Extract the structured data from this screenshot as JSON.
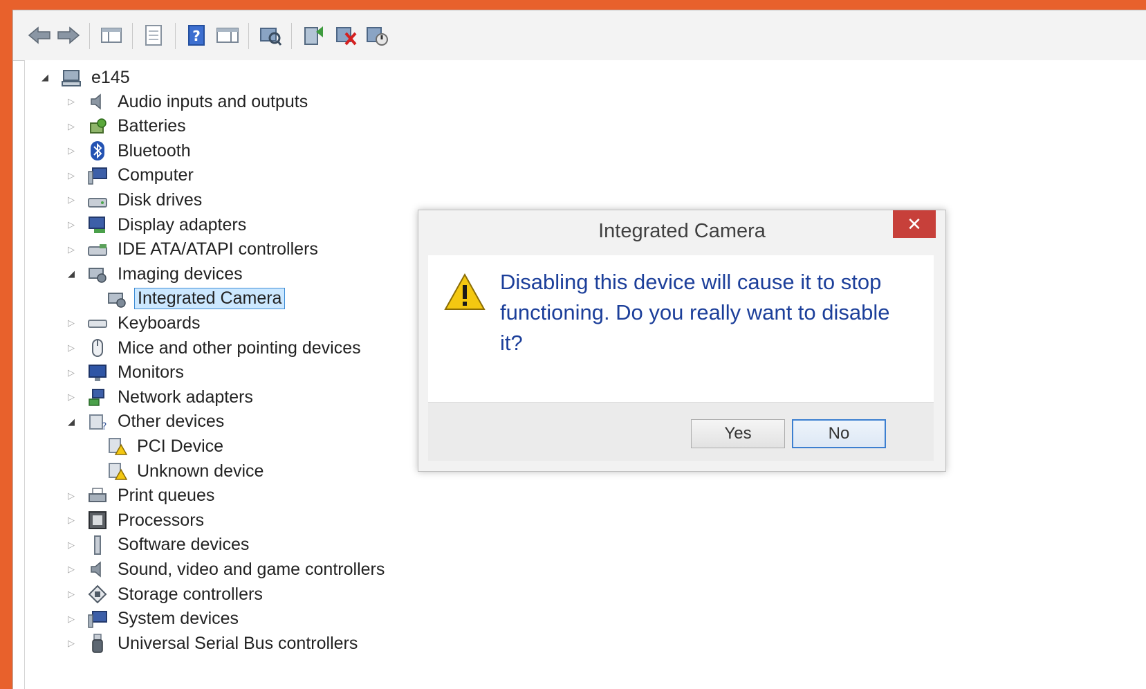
{
  "toolbar": {
    "buttons": [
      {
        "name": "back-arrow-icon"
      },
      {
        "name": "forward-arrow-icon"
      },
      {
        "name": "show-hide-console-tree-icon"
      },
      {
        "name": "properties-icon"
      },
      {
        "name": "help-icon"
      },
      {
        "name": "show-hide-action-pane-icon"
      },
      {
        "name": "scan-hardware-changes-icon"
      },
      {
        "name": "update-driver-icon"
      },
      {
        "name": "uninstall-device-icon"
      },
      {
        "name": "disable-device-icon"
      }
    ]
  },
  "tree": {
    "root": "e145",
    "items": [
      {
        "label": "Audio inputs and outputs",
        "icon": "speaker-icon",
        "expanded": false
      },
      {
        "label": "Batteries",
        "icon": "battery-icon",
        "expanded": false
      },
      {
        "label": "Bluetooth",
        "icon": "bluetooth-icon",
        "expanded": false
      },
      {
        "label": "Computer",
        "icon": "computer-icon",
        "expanded": false
      },
      {
        "label": "Disk drives",
        "icon": "disk-drive-icon",
        "expanded": false
      },
      {
        "label": "Display adapters",
        "icon": "display-adapter-icon",
        "expanded": false
      },
      {
        "label": "IDE ATA/ATAPI controllers",
        "icon": "ide-controller-icon",
        "expanded": false
      },
      {
        "label": "Imaging devices",
        "icon": "imaging-device-icon",
        "expanded": true
      },
      {
        "label": "Integrated Camera",
        "icon": "camera-icon",
        "child": true,
        "selected": true
      },
      {
        "label": "Keyboards",
        "icon": "keyboard-icon",
        "expanded": false
      },
      {
        "label": "Mice and other pointing devices",
        "icon": "mouse-icon",
        "expanded": false
      },
      {
        "label": "Monitors",
        "icon": "monitor-icon",
        "expanded": false
      },
      {
        "label": "Network adapters",
        "icon": "network-adapter-icon",
        "expanded": false
      },
      {
        "label": "Other devices",
        "icon": "other-devices-icon",
        "expanded": true
      },
      {
        "label": "PCI Device",
        "icon": "unknown-device-warning-icon",
        "child": true
      },
      {
        "label": "Unknown device",
        "icon": "unknown-device-warning-icon",
        "child": true
      },
      {
        "label": "Print queues",
        "icon": "printer-icon",
        "expanded": false
      },
      {
        "label": "Processors",
        "icon": "processor-icon",
        "expanded": false
      },
      {
        "label": "Software devices",
        "icon": "software-device-icon",
        "expanded": false
      },
      {
        "label": "Sound, video and game controllers",
        "icon": "sound-controller-icon",
        "expanded": false
      },
      {
        "label": "Storage controllers",
        "icon": "storage-controller-icon",
        "expanded": false
      },
      {
        "label": "System devices",
        "icon": "system-device-icon",
        "expanded": false
      },
      {
        "label": "Universal Serial Bus controllers",
        "icon": "usb-icon",
        "expanded": false
      }
    ]
  },
  "dialog": {
    "title": "Integrated Camera",
    "close_label": "✕",
    "message": "Disabling this device will cause it to stop functioning. Do you really want to disable it?",
    "yes_label": "Yes",
    "no_label": "No"
  },
  "colors": {
    "background": "#e8612c",
    "dialog_text": "#1c3f9a",
    "close_button": "#c7403a",
    "selection": "#cce8ff"
  }
}
